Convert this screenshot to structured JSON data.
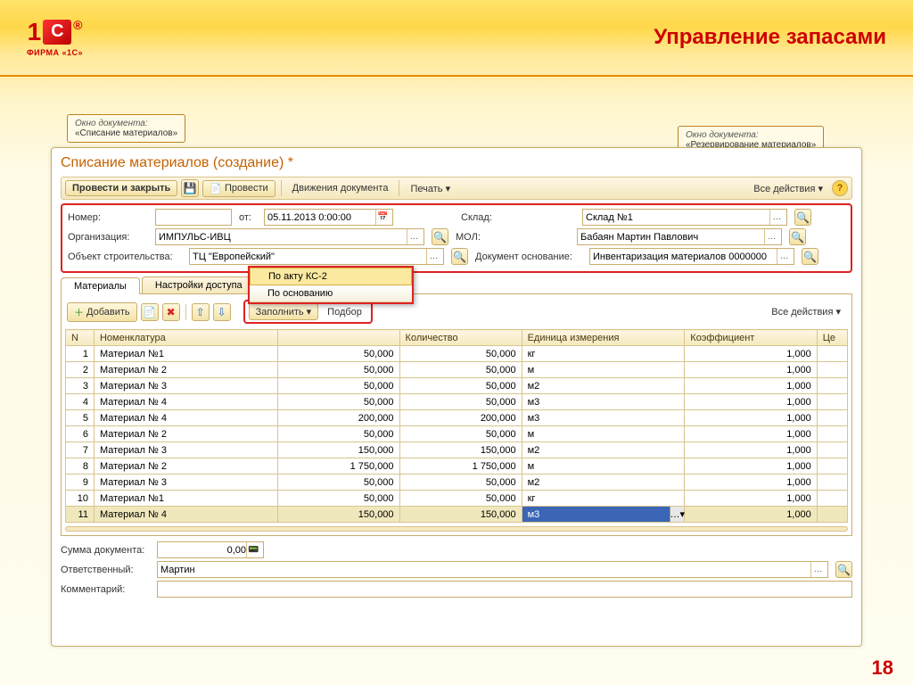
{
  "slide": {
    "title": "Управление запасами",
    "page": "18",
    "brand": "ФИРМА «1С»",
    "logo_1": "1"
  },
  "callout1": {
    "label": "Окно документа:",
    "text": "«Списание материалов»"
  },
  "callout2": {
    "label": "Окно документа:",
    "text": "«Резервирование материалов»"
  },
  "doc": {
    "title": "Списание материалов (создание) *",
    "toolbar": {
      "post_close": "Провести и закрыть",
      "post": "Провести",
      "movements": "Движения документа",
      "print": "Печать",
      "all_actions": "Все действия"
    },
    "form": {
      "number_label": "Номер:",
      "date_label": "от:",
      "date_value": "05.11.2013  0:00:00",
      "org_label": "Организация:",
      "org_value": "ИМПУЛЬС-ИВЦ",
      "obj_label": "Объект строительства:",
      "obj_value": "ТЦ \"Европейский\"",
      "sklad_label": "Склад:",
      "sklad_value": "Склад №1",
      "mol_label": "МОЛ:",
      "mol_value": "Бабаян Мартин Павлович",
      "basis_label": "Документ основание:",
      "basis_value": "Инвентаризация материалов 0000000"
    },
    "tabs": {
      "t1": "Материалы",
      "t2": "Настройки доступа"
    },
    "tbl_toolbar": {
      "add": "Добавить",
      "fill": "Заполнить",
      "pick": "Подбор",
      "all_actions": "Все действия"
    },
    "dropdown": {
      "opt1": "По акту КС-2",
      "opt2": "По основанию"
    },
    "grid": {
      "headers": {
        "n": "N",
        "nm": "Номенклатура",
        "q1": "",
        "q2": "Количество",
        "unit": "Единица измерения",
        "coef": "Коэффициент",
        "price": "Це"
      },
      "rows": [
        {
          "n": "1",
          "nm": "Материал №1",
          "q1": "50,000",
          "q2": "50,000",
          "unit": "кг",
          "coef": "1,000"
        },
        {
          "n": "2",
          "nm": "Материал № 2",
          "q1": "50,000",
          "q2": "50,000",
          "unit": "м",
          "coef": "1,000"
        },
        {
          "n": "3",
          "nm": "Материал № 3",
          "q1": "50,000",
          "q2": "50,000",
          "unit": "м2",
          "coef": "1,000"
        },
        {
          "n": "4",
          "nm": "Материал № 4",
          "q1": "50,000",
          "q2": "50,000",
          "unit": "м3",
          "coef": "1,000"
        },
        {
          "n": "5",
          "nm": "Материал № 4",
          "q1": "200,000",
          "q2": "200,000",
          "unit": "м3",
          "coef": "1,000"
        },
        {
          "n": "6",
          "nm": "Материал № 2",
          "q1": "50,000",
          "q2": "50,000",
          "unit": "м",
          "coef": "1,000"
        },
        {
          "n": "7",
          "nm": "Материал № 3",
          "q1": "150,000",
          "q2": "150,000",
          "unit": "м2",
          "coef": "1,000"
        },
        {
          "n": "8",
          "nm": "Материал № 2",
          "q1": "1 750,000",
          "q2": "1 750,000",
          "unit": "м",
          "coef": "1,000"
        },
        {
          "n": "9",
          "nm": "Материал № 3",
          "q1": "50,000",
          "q2": "50,000",
          "unit": "м2",
          "coef": "1,000"
        },
        {
          "n": "10",
          "nm": "Материал №1",
          "q1": "50,000",
          "q2": "50,000",
          "unit": "кг",
          "coef": "1,000"
        },
        {
          "n": "11",
          "nm": "Материал № 4",
          "q1": "150,000",
          "q2": "150,000",
          "unit": "м3",
          "coef": "1,000"
        }
      ]
    },
    "footer": {
      "sum_label": "Сумма документа:",
      "sum_value": "0,00",
      "resp_label": "Ответственный:",
      "resp_value": "Мартин",
      "comment_label": "Комментарий:"
    }
  }
}
